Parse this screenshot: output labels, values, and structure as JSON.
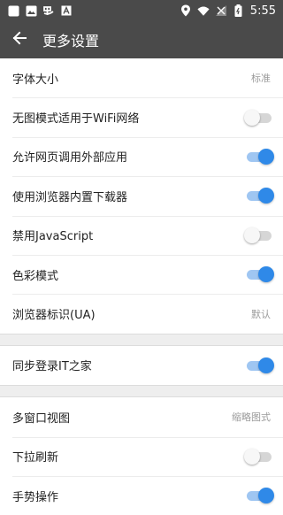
{
  "status_bar": {
    "time": "5:55",
    "left_icons": [
      "square-icon",
      "image-icon",
      "app-icon",
      "font-icon"
    ],
    "right_icons": [
      "location-icon",
      "wifi-icon",
      "signal-icon",
      "battery-icon"
    ]
  },
  "app_bar": {
    "title": "更多设置",
    "back_icon": "arrow-left-icon"
  },
  "colors": {
    "bar_bg": "#4a4a4a",
    "accent": "#2f89e8",
    "toggle_off": "#d6d6d6"
  },
  "groups": [
    {
      "items": [
        {
          "label": "字体大小",
          "type": "value",
          "value": "标准"
        },
        {
          "label": "无图模式适用于WiFi网络",
          "type": "toggle",
          "on": false
        },
        {
          "label": "允许网页调用外部应用",
          "type": "toggle",
          "on": true
        },
        {
          "label": "使用浏览器内置下载器",
          "type": "toggle",
          "on": true
        },
        {
          "label": "禁用JavaScript",
          "type": "toggle",
          "on": false
        },
        {
          "label": "色彩模式",
          "type": "toggle",
          "on": true
        },
        {
          "label": "浏览器标识(UA)",
          "type": "value",
          "value": "默认"
        }
      ]
    },
    {
      "items": [
        {
          "label": "同步登录IT之家",
          "type": "toggle",
          "on": true
        }
      ]
    },
    {
      "items": [
        {
          "label": "多窗口视图",
          "type": "value",
          "value": "缩略图式"
        },
        {
          "label": "下拉刷新",
          "type": "toggle",
          "on": false
        },
        {
          "label": "手势操作",
          "type": "toggle",
          "on": true
        }
      ]
    }
  ]
}
